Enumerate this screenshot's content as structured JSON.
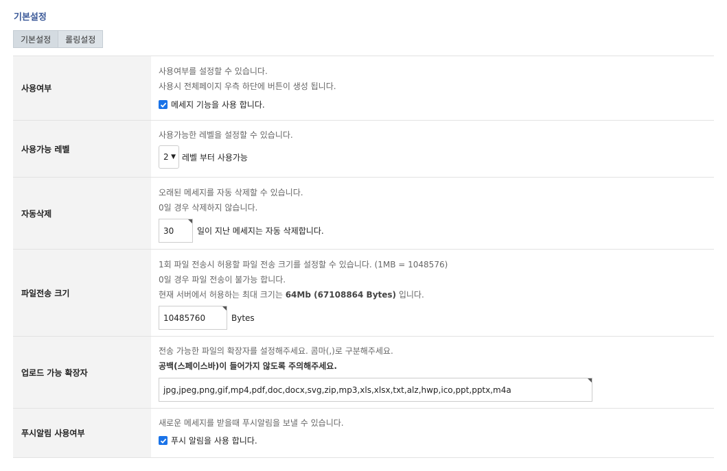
{
  "page_title": "기본설정",
  "tabs": [
    {
      "label": "기본설정"
    },
    {
      "label": "롤링설정"
    }
  ],
  "rows": {
    "usage": {
      "label": "사용여부",
      "desc1": "사용여부를 설정할 수 있습니다.",
      "desc2": "사용시 전체페이지 우측 하단에 버튼이 생성 됩니다.",
      "checkbox_label": "메세지 기능을 사용 합니다.",
      "checked": true
    },
    "level": {
      "label": "사용가능 레벨",
      "desc1": "사용가능한 레벨을 설정할 수 있습니다.",
      "select_value": "2",
      "suffix": "레벨 부터 사용가능"
    },
    "auto_delete": {
      "label": "자동삭제",
      "desc1": "오래된 메세지를 자동 삭제할 수 있습니다.",
      "desc2": "0일 경우 삭제하지 않습니다.",
      "input_value": "30",
      "suffix": "일이 지난 메세지는 자동 삭제합니다."
    },
    "file_size": {
      "label": "파일전송 크기",
      "desc1": "1회 파일 전송시 허용할 파일 전송 크기를 설정할 수 있습니다. (1MB = 1048576)",
      "desc2": "0일 경우 파일 전송이 불가능 합니다.",
      "desc3_prefix": "현재 서버에서 허용하는 최대 크기는 ",
      "desc3_bold": "64Mb (67108864 Bytes)",
      "desc3_suffix": " 입니다.",
      "input_value": "10485760",
      "suffix": "Bytes"
    },
    "extensions": {
      "label": "업로드 가능 확장자",
      "desc1": "전송 가능한 파일의 확장자를 설정해주세요. 콤마(,)로 구분해주세요.",
      "desc2": "공백(스페이스바)이 들어가지 않도록 주의해주세요.",
      "input_value": "jpg,jpeg,png,gif,mp4,pdf,doc,docx,svg,zip,mp3,xls,xlsx,txt,alz,hwp,ico,ppt,pptx,m4a"
    },
    "push": {
      "label": "푸시알림 사용여부",
      "desc1": "새로운 메세지를 받을때 푸시알림을 보낼 수 있습니다.",
      "checkbox_label": "푸시 알림을 사용 합니다.",
      "checked": true
    }
  },
  "colors": {
    "title": "#3b5998",
    "checkbox": "#1a73e8",
    "label_bg": "#f3f3f3"
  },
  "icons": {
    "checkbox": "checkmark-icon",
    "select": "chevron-down-icon"
  }
}
